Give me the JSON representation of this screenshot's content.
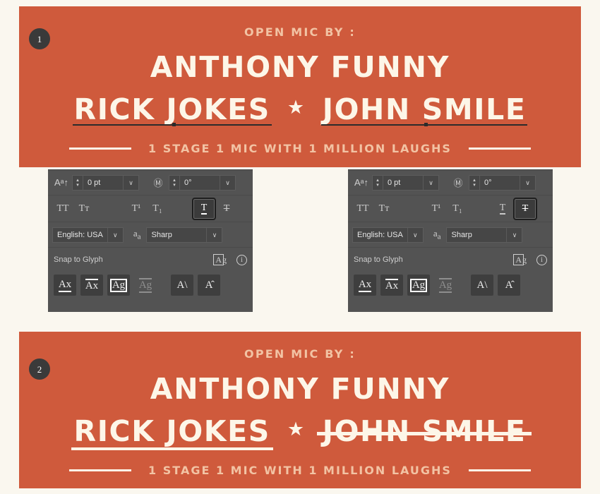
{
  "page": {
    "background_color": "#faf7ef",
    "banner_color": "#cf5a3c",
    "cream_color": "#fdf6e8",
    "peach_color": "#f2c3a4",
    "badge_color": "#3a3a3a"
  },
  "banners": [
    {
      "number": "1",
      "kicker": "OPEN MIC BY :",
      "headline": "ANTHONY FUNNY",
      "name_left": "RICK JOKES",
      "separator": "★",
      "name_right": "JOHN SMILE",
      "tagline": "1 STAGE 1 MIC WITH 1 MILLION LAUGHS",
      "decoration": "underline-dark"
    },
    {
      "number": "2",
      "kicker": "OPEN MIC BY :",
      "headline": "ANTHONY FUNNY",
      "name_left": "RICK JOKES",
      "separator": "★",
      "name_right": "JOHN SMILE",
      "tagline": "1 STAGE 1 MIC WITH 1 MILLION LAUGHS",
      "decoration_left": "underline-cream",
      "decoration_right": "strike-cream"
    }
  ],
  "panels": [
    {
      "id": "left",
      "baseline_shift": {
        "icon": "baseline-shift-icon",
        "value": "0 pt",
        "caret": "∨"
      },
      "rotation": {
        "icon": "character-rotation-icon",
        "value": "0°",
        "caret": "∨"
      },
      "style_buttons": [
        {
          "name": "all-caps",
          "glyph": "TT",
          "active": false
        },
        {
          "name": "small-caps",
          "glyph": "Tᴛ",
          "active": false
        },
        {
          "name": "superscript",
          "glyph": "T¹",
          "active": false
        },
        {
          "name": "subscript",
          "glyph": "T₁",
          "active": false
        },
        {
          "name": "underline",
          "glyph": "T",
          "active": true
        },
        {
          "name": "strikethrough",
          "glyph": "T",
          "active": false
        }
      ],
      "language": {
        "value": "English: USA",
        "caret": "∨"
      },
      "antialias": {
        "icon": "anti-alias-icon",
        "value": "Sharp",
        "caret": "∨"
      },
      "snap_to_glyph": {
        "label": "Snap to Glyph",
        "preview_icon": "Ag",
        "info_icon": "i"
      },
      "glyph_buttons": [
        {
          "name": "snap-baseline",
          "glyph": "Ax",
          "state": "normal"
        },
        {
          "name": "snap-x-height",
          "glyph": "Ax",
          "state": "normal"
        },
        {
          "name": "snap-em-box",
          "glyph": "Ag",
          "state": "selected"
        },
        {
          "name": "snap-disabled",
          "glyph": "Ag",
          "state": "disabled"
        },
        {
          "name": "snap-italic-angle",
          "glyph": "A",
          "state": "normal"
        },
        {
          "name": "snap-rotation",
          "glyph": "A",
          "state": "normal"
        }
      ]
    },
    {
      "id": "right",
      "baseline_shift": {
        "icon": "baseline-shift-icon",
        "value": "0 pt",
        "caret": "∨"
      },
      "rotation": {
        "icon": "character-rotation-icon",
        "value": "0°",
        "caret": "∨"
      },
      "style_buttons": [
        {
          "name": "all-caps",
          "glyph": "TT",
          "active": false
        },
        {
          "name": "small-caps",
          "glyph": "Tᴛ",
          "active": false
        },
        {
          "name": "superscript",
          "glyph": "T¹",
          "active": false
        },
        {
          "name": "subscript",
          "glyph": "T₁",
          "active": false
        },
        {
          "name": "underline",
          "glyph": "T",
          "active": false
        },
        {
          "name": "strikethrough",
          "glyph": "T",
          "active": true
        }
      ],
      "language": {
        "value": "English: USA",
        "caret": "∨"
      },
      "antialias": {
        "icon": "anti-alias-icon",
        "value": "Sharp",
        "caret": "∨"
      },
      "snap_to_glyph": {
        "label": "Snap to Glyph",
        "preview_icon": "Ag",
        "info_icon": "i"
      },
      "glyph_buttons": [
        {
          "name": "snap-baseline",
          "glyph": "Ax",
          "state": "normal"
        },
        {
          "name": "snap-x-height",
          "glyph": "Ax",
          "state": "normal"
        },
        {
          "name": "snap-em-box",
          "glyph": "Ag",
          "state": "selected"
        },
        {
          "name": "snap-disabled",
          "glyph": "Ag",
          "state": "disabled"
        },
        {
          "name": "snap-italic-angle",
          "glyph": "A",
          "state": "normal"
        },
        {
          "name": "snap-rotation",
          "glyph": "A",
          "state": "normal"
        }
      ]
    }
  ]
}
